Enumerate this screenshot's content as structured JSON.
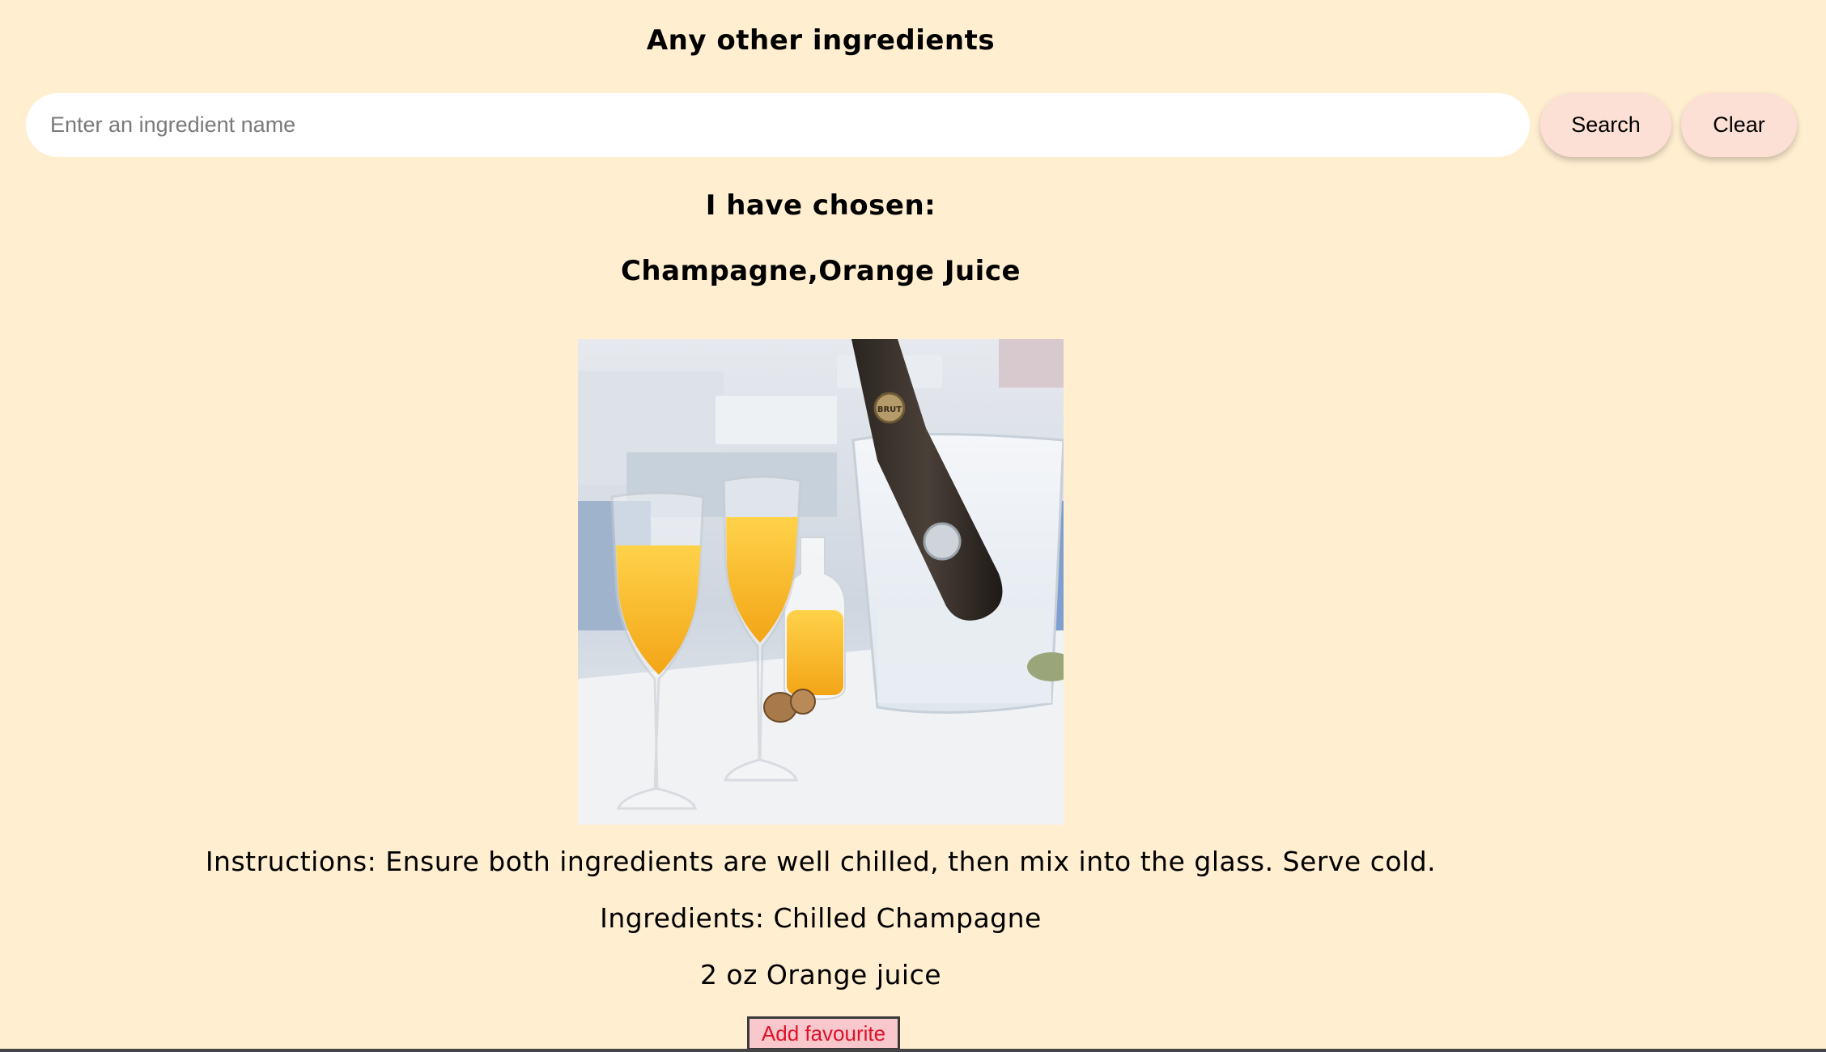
{
  "header": {
    "title": "Any other ingredients"
  },
  "search": {
    "placeholder": "Enter an ingredient name",
    "value": "",
    "search_label": "Search",
    "clear_label": "Clear"
  },
  "chosen": {
    "label": "I have chosen:",
    "ingredients": "Champagne,Orange Juice"
  },
  "recipe": {
    "instructions": "Instructions: Ensure both ingredients are well chilled, then mix into the glass. Serve cold.",
    "ingredients_line1": "Ingredients: Chilled Champagne",
    "ingredients_line2": "2 oz Orange juice",
    "bottle_label": "BRUT",
    "favourite_label": "Add favourite"
  },
  "colors": {
    "background": "#ffeed0",
    "button": "#fde0d5",
    "favourite_bg": "#f9c8cc",
    "favourite_text": "#e0102a"
  }
}
